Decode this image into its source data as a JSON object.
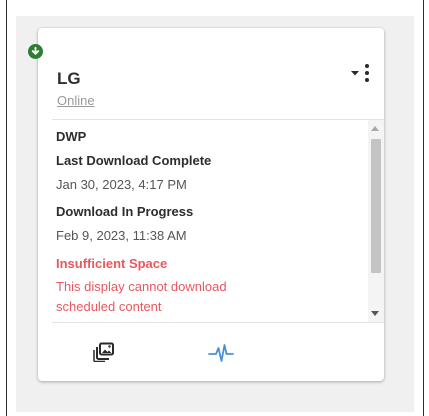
{
  "device": {
    "name": "LG",
    "status": "Online",
    "status_icon": "download-arrow-icon",
    "status_color": "#2e7d32"
  },
  "details": {
    "player_type": "DWP",
    "last_download_label": "Last Download Complete",
    "last_download_value": "Jan 30, 2023, 4:17 PM",
    "in_progress_label": "Download In Progress",
    "in_progress_value": "Feb 9, 2023, 11:38 AM",
    "error_title": "Insufficient Space",
    "error_line1": "This display cannot download",
    "error_line2": "scheduled content",
    "error_color": "#e8585f"
  },
  "actions": {
    "gallery_icon": "photo-gallery-icon",
    "pulse_icon": "activity-pulse-icon",
    "pulse_color": "#4a90d9"
  },
  "menu": {
    "caret_icon": "caret-down-icon",
    "kebab_icon": "kebab-menu-icon"
  }
}
